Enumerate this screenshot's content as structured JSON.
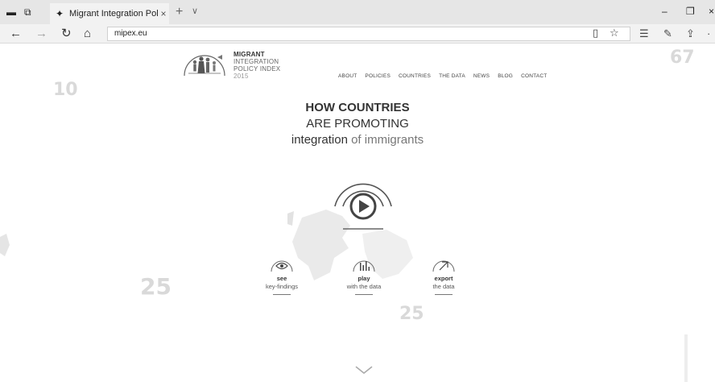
{
  "browser": {
    "tab_title": "Migrant Integration Poli",
    "tab_close": "×",
    "new_tab": "+",
    "tab_menu": "∨",
    "address": "mipex.eu",
    "win_minimize": "–",
    "win_restore": "❐",
    "win_close": "×",
    "more": "·"
  },
  "site": {
    "logo": {
      "line1": "MIGRANT",
      "line2": "INTEGRATION",
      "line3": "POLICY INDEX",
      "year": "2015"
    },
    "nav": [
      "ABOUT",
      "POLICIES",
      "COUNTRIES",
      "THE DATA",
      "NEWS",
      "BLOG",
      "CONTACT"
    ],
    "headline": {
      "line1": "HOW COUNTRIES",
      "line2": "ARE PROMOTING",
      "line3_emphasis": "integration",
      "line3_rest": " of immigrants"
    },
    "actions": [
      {
        "title": "see",
        "subtitle": "key-findings",
        "icon": "eye-icon"
      },
      {
        "title": "play",
        "subtitle": "with the data",
        "icon": "bar-chart-icon"
      },
      {
        "title": "export",
        "subtitle": "the data",
        "icon": "arrow-up-right-icon"
      }
    ],
    "background_numbers": [
      "10",
      "67",
      "25",
      "25"
    ]
  },
  "colors": {
    "text": "#333333",
    "muted": "#777777",
    "background_number": "#d9d9d9"
  }
}
